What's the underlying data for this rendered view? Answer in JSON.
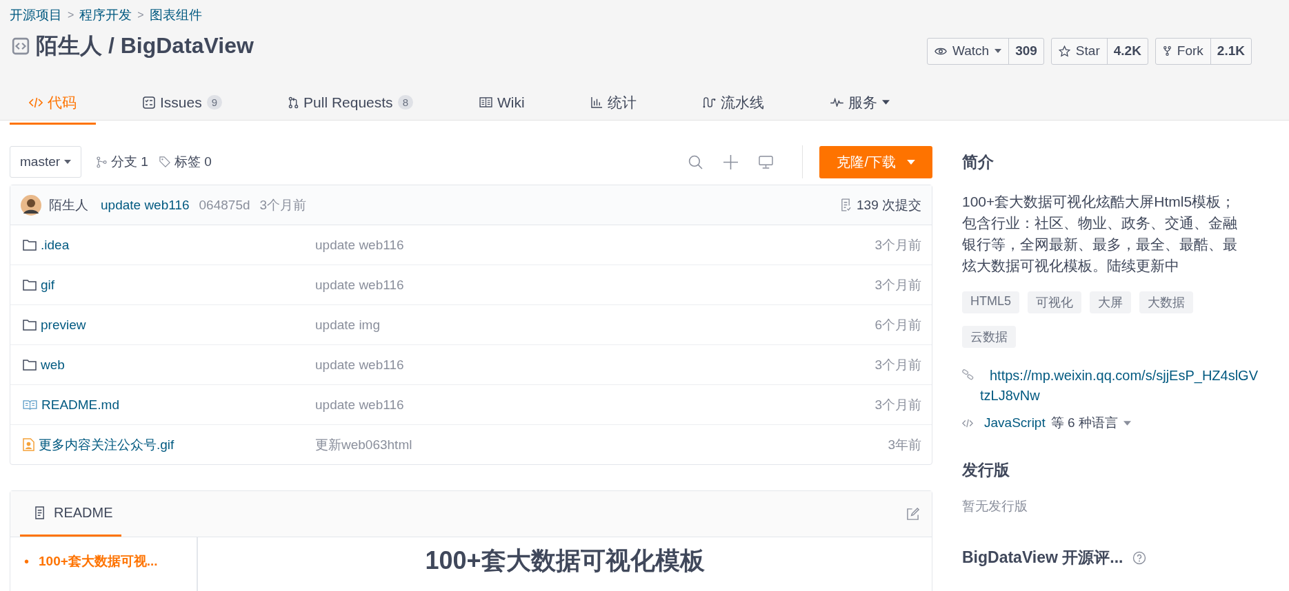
{
  "breadcrumb": [
    {
      "kind": "link",
      "label": "开源项目"
    },
    {
      "kind": "separator",
      "label": ">"
    },
    {
      "kind": "link",
      "label": "程序开发"
    },
    {
      "kind": "separator",
      "label": ">"
    },
    {
      "kind": "link",
      "label": "图表组件"
    }
  ],
  "repo_title": "陌生人 / BigDataView",
  "actions": [
    {
      "kind": "watch",
      "label": "Watch",
      "count": "309",
      "dropdown": true
    },
    {
      "kind": "star",
      "label": "Star",
      "count": "4.2K",
      "dropdown": false
    },
    {
      "kind": "fork",
      "label": "Fork",
      "count": "2.1K",
      "dropdown": false
    }
  ],
  "tabs": [
    {
      "kind": "code",
      "label": "代码",
      "selected": true
    },
    {
      "kind": "issues",
      "label": "Issues",
      "count": "9",
      "selected": false
    },
    {
      "kind": "pulls",
      "label": "Pull Requests",
      "count": "8",
      "selected": false
    },
    {
      "kind": "wiki",
      "label": "Wiki",
      "selected": false
    },
    {
      "kind": "stats",
      "label": "统计",
      "selected": false
    },
    {
      "kind": "pipeline",
      "label": "流水线",
      "selected": false
    },
    {
      "kind": "service",
      "label": "服务",
      "selected": false,
      "dropdown": true
    }
  ],
  "toolbar": {
    "branch": "master",
    "branches": "分支 1",
    "tags": "标签 0",
    "clone_button": "克隆/下载"
  },
  "commit": {
    "author": "陌生人",
    "message": "update web116",
    "hash": "064875d",
    "time": "3个月前",
    "count": "139 次提交"
  },
  "files": [
    {
      "kind": "folder",
      "name": ".idea",
      "message": "update web116",
      "time": "3个月前"
    },
    {
      "kind": "folder",
      "name": "gif",
      "message": "update web116",
      "time": "3个月前"
    },
    {
      "kind": "folder",
      "name": "preview",
      "message": "update img",
      "time": "6个月前"
    },
    {
      "kind": "folder",
      "name": "web",
      "message": "update web116",
      "time": "3个月前"
    },
    {
      "kind": "readme",
      "name": "README.md",
      "message": "update web116",
      "time": "3个月前"
    },
    {
      "kind": "image",
      "name": "更多内容关注公众号.gif",
      "message": "更新web063html",
      "time": "3年前"
    }
  ],
  "readme": {
    "title": "README",
    "toc": [
      {
        "bullet": "•",
        "label": "100+套大数据可视...",
        "selected": true
      }
    ],
    "heading": "100+套大数据可视化模板"
  },
  "sidebar": {
    "intro_title": "简介",
    "description": "100+套大数据可视化炫酷大屏Html5模板；包含行业：社区、物业、政务、交通、金融银行等，全网最新、最多，最全、最酷、最炫大数据可视化模板。陆续更新中",
    "tags": [
      "HTML5",
      "可视化",
      "大屏",
      "大数据",
      "云数据"
    ],
    "link": "https://mp.weixin.qq.com/s/sjjEsP_HZ4slGVtzLJ8vNw",
    "language": "JavaScript",
    "language_suffix": "等 6 种语言",
    "releases_title": "发行版",
    "releases_empty": "暂无发行版",
    "evaluation_title": "BigDataView 开源评..."
  }
}
